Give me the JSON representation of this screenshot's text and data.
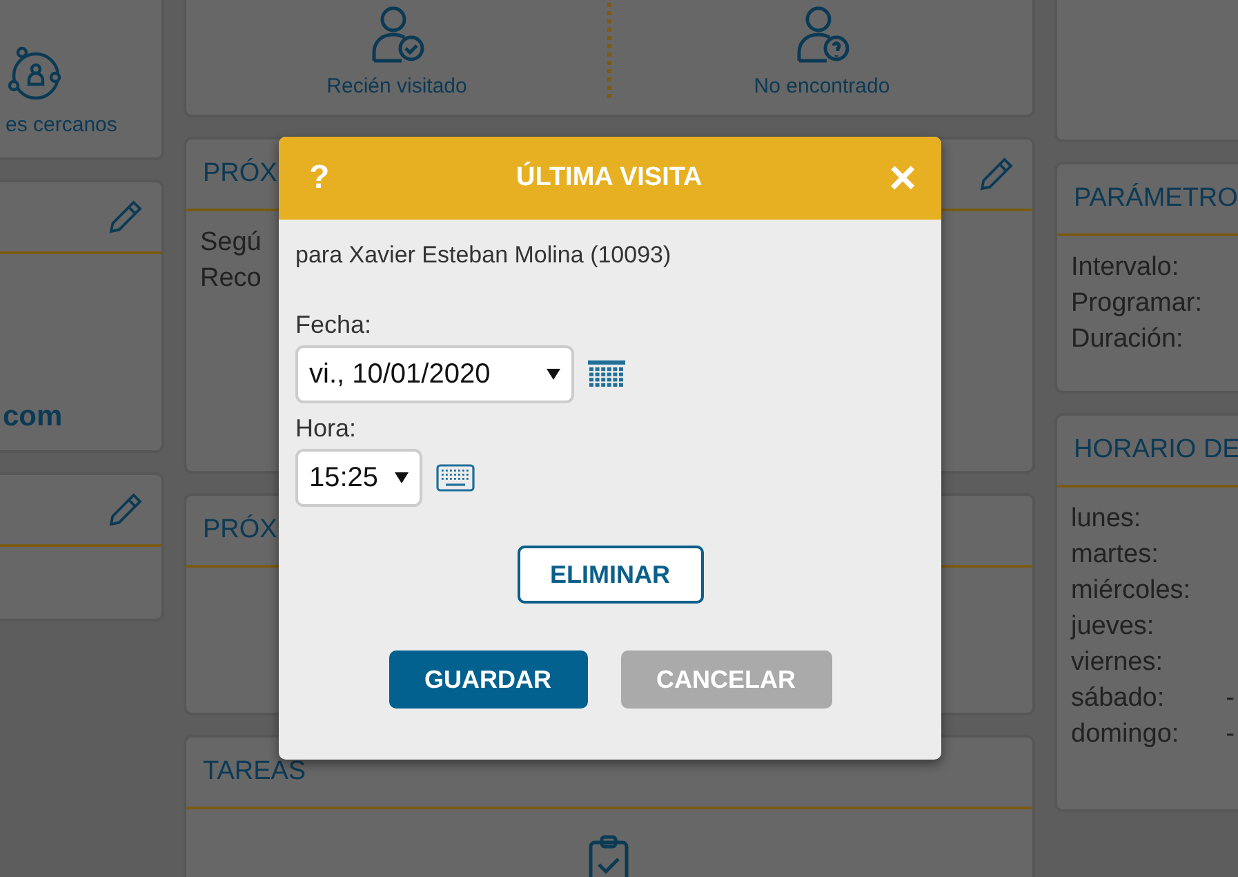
{
  "left_cards": [
    {
      "label": "es cercanos",
      "kind": "nearby"
    },
    {
      "value": "com",
      "editable": true,
      "kind": "contact"
    },
    {
      "editable": true,
      "kind": "empty"
    }
  ],
  "status_tiles": [
    {
      "label": "Recién visitado",
      "kind": "visited"
    },
    {
      "label": "No encontrado",
      "kind": "unknown"
    }
  ],
  "middle_cards": [
    {
      "title": "PRÓX",
      "editable": true,
      "lines": [
        "Segú",
        "Reco"
      ],
      "kind": "text"
    },
    {
      "title": "PRÓX",
      "editable": false,
      "kind": "text"
    },
    {
      "title": "TAREAS",
      "editable": false,
      "kind": "tasks"
    }
  ],
  "parameters": {
    "title": "PARÁMETRO",
    "rows": [
      "Intervalo:",
      "Programar:",
      "Duración:"
    ]
  },
  "schedule": {
    "title": "HORARIO DE",
    "rows": [
      {
        "day": "lunes:"
      },
      {
        "day": "martes:"
      },
      {
        "day": "miércoles:"
      },
      {
        "day": "jueves:"
      },
      {
        "day": "viernes:"
      },
      {
        "day": "sábado:",
        "value": "-"
      },
      {
        "day": "domingo:",
        "value": "-"
      }
    ]
  },
  "dialog": {
    "help": "?",
    "title": "ÚLTIMA VISITA",
    "close": "×",
    "subtitle": "para Xavier Esteban Molina (10093)",
    "fields": [
      {
        "kind": "date",
        "label": "Fecha:",
        "value": "vi., 10/01/2020"
      },
      {
        "kind": "time",
        "label": "Hora:",
        "value": "15:25"
      }
    ],
    "delete_button": "ELIMINAR",
    "buttons": [
      {
        "label": "GUARDAR",
        "kind": "primary"
      },
      {
        "label": "CANCELAR",
        "kind": "secondary"
      }
    ]
  }
}
